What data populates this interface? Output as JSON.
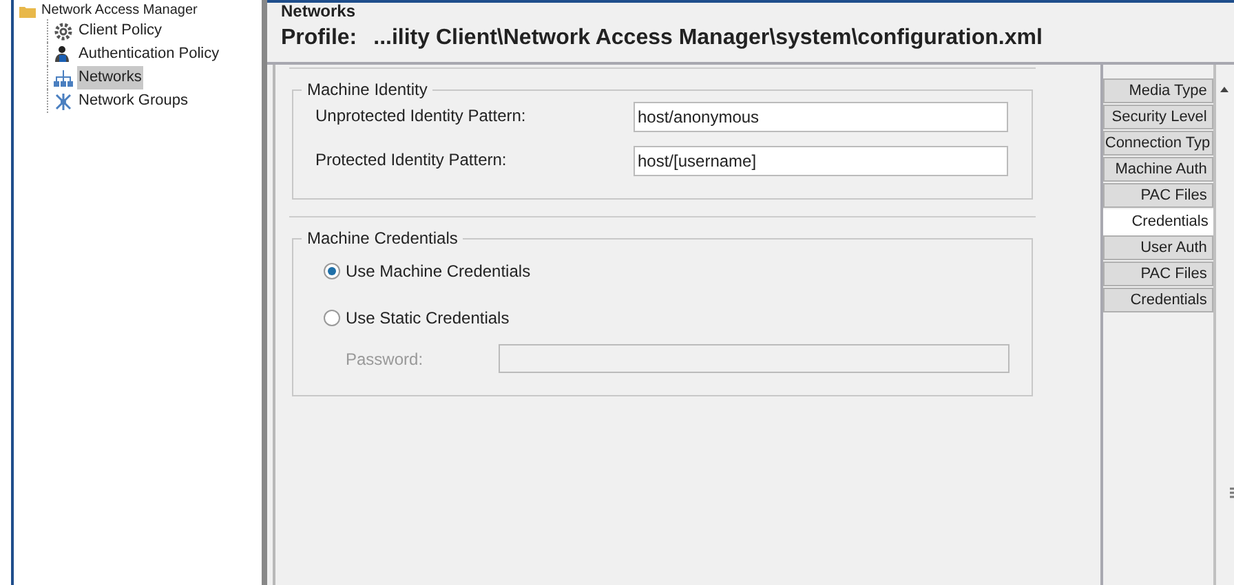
{
  "tree": {
    "root": "Network Access Manager",
    "items": [
      {
        "label": "Client Policy",
        "kind": "gear",
        "selected": false
      },
      {
        "label": "Authentication Policy",
        "kind": "user",
        "selected": false
      },
      {
        "label": "Networks",
        "kind": "network",
        "selected": true
      },
      {
        "label": "Network Groups",
        "kind": "group",
        "selected": false
      }
    ]
  },
  "heading": "Networks",
  "profile": {
    "label": "Profile:",
    "path": "...ility Client\\Network Access Manager\\system\\configuration.xml"
  },
  "machine_identity": {
    "title": "Machine Identity",
    "fields": [
      {
        "label": "Unprotected Identity Pattern:",
        "value": "host/anonymous"
      },
      {
        "label": "Protected Identity Pattern:",
        "value": "host/[username]"
      }
    ]
  },
  "machine_credentials": {
    "title": "Machine Credentials",
    "options": [
      {
        "label": "Use Machine Credentials",
        "selected": true
      },
      {
        "label": "Use Static Credentials",
        "selected": false
      }
    ],
    "password": {
      "label": "Password:",
      "disabled": true
    }
  },
  "side_tabs": [
    {
      "label": "Media Type",
      "selected": false
    },
    {
      "label": "Security Level",
      "selected": false
    },
    {
      "label": "Connection Typ",
      "selected": false
    },
    {
      "label": "Machine Auth",
      "selected": false
    },
    {
      "label": "PAC Files",
      "selected": false
    },
    {
      "label": "Credentials",
      "selected": true
    },
    {
      "label": "User Auth",
      "selected": false
    },
    {
      "label": "PAC Files",
      "selected": false
    },
    {
      "label": "Credentials",
      "selected": false
    }
  ]
}
